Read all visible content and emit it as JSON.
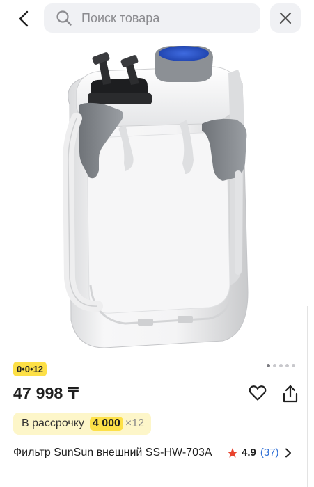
{
  "header": {
    "search_placeholder": "Поиск товара",
    "back_icon": "chevron-left-icon",
    "close_icon": "close-icon",
    "search_icon": "search-icon"
  },
  "gallery": {
    "image_alt": "Фильтр SunSun внешний SS-HW-703A",
    "image_count": 5,
    "active_index": 0
  },
  "product": {
    "promo_badge": "0•0•12",
    "price": "47 998 ₸",
    "installment": {
      "label": "В рассрочку",
      "amount": "4 000",
      "months": "×12"
    },
    "title": "Фильтр SunSun внешний SS-HW-703A",
    "rating": {
      "score": "4.9",
      "count": "(37)"
    }
  },
  "colors": {
    "badge_yellow": "#fde047",
    "installment_bg": "#fdf6c9",
    "link_blue": "#2f6fd6",
    "star_red": "#e8432e",
    "search_bg": "#f0f1f4"
  }
}
